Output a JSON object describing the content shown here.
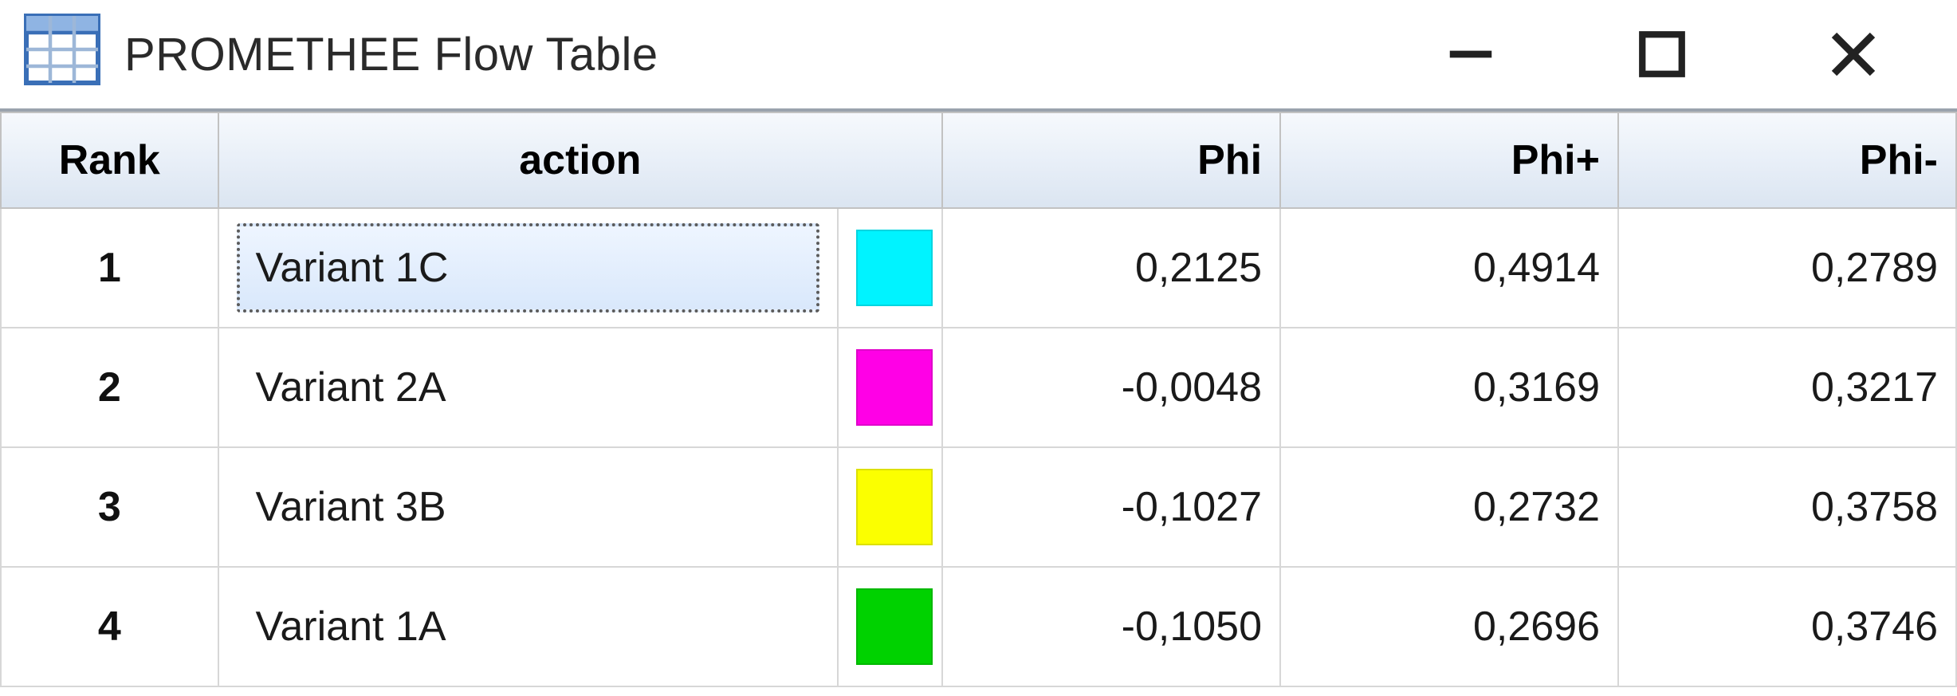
{
  "window": {
    "title": "PROMETHEE Flow Table"
  },
  "table": {
    "headers": {
      "rank": "Rank",
      "action": "action",
      "phi": "Phi",
      "phi_plus": "Phi+",
      "phi_minus": "Phi-"
    },
    "rows": [
      {
        "rank": "1",
        "action": "Variant 1C",
        "color": "#00f3ff",
        "phi": "0,2125",
        "phi_plus": "0,4914",
        "phi_minus": "0,2789",
        "selected": true
      },
      {
        "rank": "2",
        "action": "Variant 2A",
        "color": "#ff00e6",
        "phi": "-0,0048",
        "phi_plus": "0,3169",
        "phi_minus": "0,3217",
        "selected": false
      },
      {
        "rank": "3",
        "action": "Variant 3B",
        "color": "#fbff00",
        "phi": "-0,1027",
        "phi_plus": "0,2732",
        "phi_minus": "0,3758",
        "selected": false
      },
      {
        "rank": "4",
        "action": "Variant 1A",
        "color": "#00d200",
        "phi": "-0,1050",
        "phi_plus": "0,2696",
        "phi_minus": "0,3746",
        "selected": false
      }
    ]
  }
}
